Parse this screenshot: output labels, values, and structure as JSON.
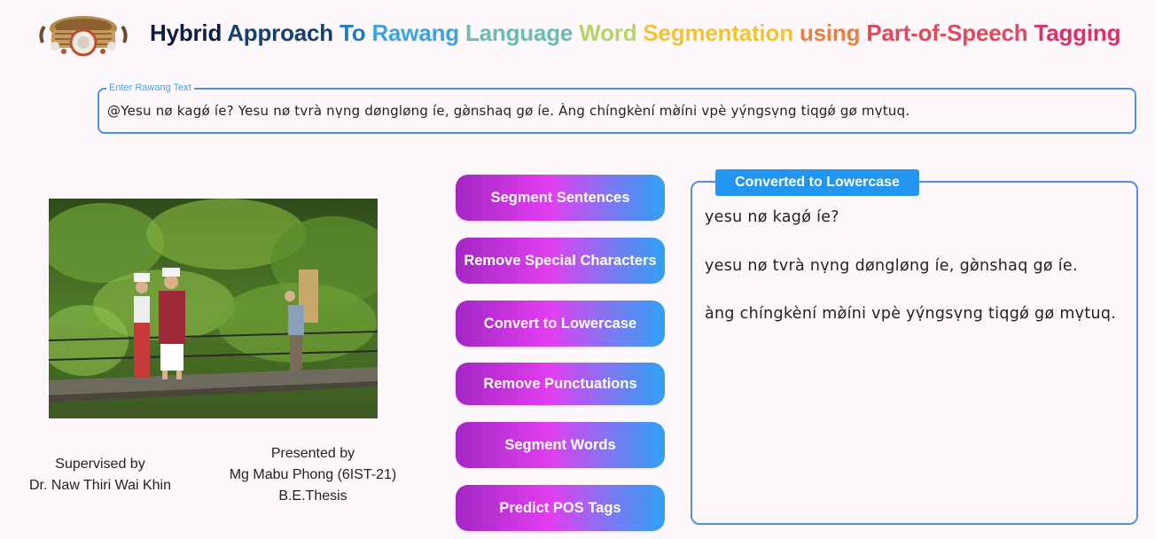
{
  "header": {
    "title_words": [
      {
        "text": "Hybrid",
        "color": "#0d1b46"
      },
      {
        "text": "Approach",
        "color": "#16406e"
      },
      {
        "text": "To",
        "color": "#1f7dbf"
      },
      {
        "text": "Rawang",
        "color": "#3ba3e4"
      },
      {
        "text": "Language",
        "color": "#68bdb2"
      },
      {
        "text": "Word",
        "color": "#b6d465"
      },
      {
        "text": "Segmentation",
        "color": "#f2c433"
      },
      {
        "text": "using",
        "color": "#ef7c43"
      },
      {
        "text": "Part-of-Speech",
        "color": "#e5485a"
      },
      {
        "text": "Tagging",
        "color": "#de2f6a"
      }
    ]
  },
  "input": {
    "label": "Enter Rawang Text",
    "value": "@Yesu nø kagǿ íe? Yesu nø tvrà nṿng døngløng íe, gø̀nshaq gø íe. Àng chíngkèní mø̀íni vpè yṿ́ngsṿng tiqgǿ gø mṿtuq."
  },
  "credits": {
    "supervised_heading": "Supervised by",
    "supervisor": "Dr. Naw Thiri Wai Khin",
    "presented_heading": "Presented by",
    "presenter": "Mg Mabu Phong (6IST-21)",
    "thesis": "B.E.Thesis"
  },
  "actions": {
    "segment_sentences": "Segment Sentences",
    "remove_special_characters": "Remove Special Characters",
    "convert_to_lowercase": "Convert to Lowercase",
    "remove_punctuations": "Remove Punctuations",
    "segment_words": "Segment Words",
    "predict_pos_tags": "Predict POS Tags"
  },
  "output": {
    "tab_label": "Converted to Lowercase",
    "lines": [
      "yesu nø kagǿ íe?",
      "yesu nø tvrà nṿng døngløng íe, gø̀nshaq gø íe.",
      "àng chíngkèní mø̀íni vpè yṿ́ngsṿng tiqgǿ gø mṿtuq."
    ]
  }
}
